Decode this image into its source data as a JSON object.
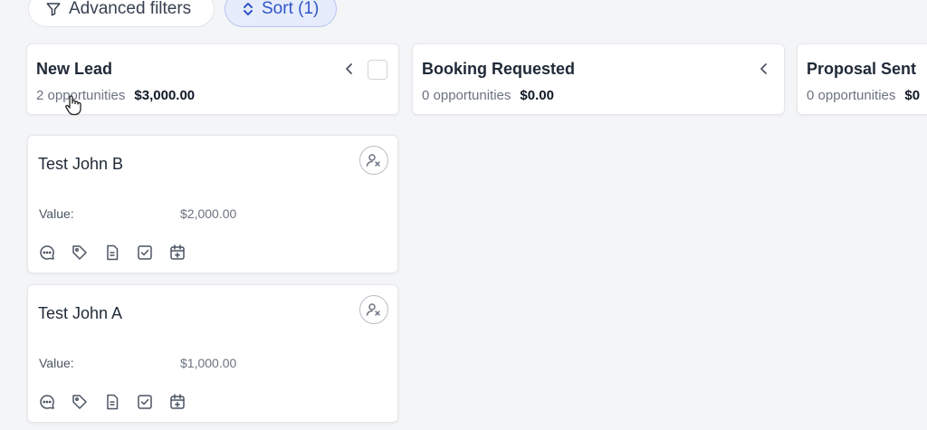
{
  "toolbar": {
    "filters_label": "Advanced filters",
    "sort_label": "Sort (1)"
  },
  "columns": [
    {
      "title": "New Lead",
      "count": "2 opportunities",
      "amount": "$3,000.00"
    },
    {
      "title": "Booking Requested",
      "count": "0 opportunities",
      "amount": "$0.00"
    },
    {
      "title": "Proposal Sent",
      "count": "0 opportunities",
      "amount": "$0"
    }
  ],
  "cards": [
    {
      "title": "Test John B",
      "value_label": "Value:",
      "value": "$2,000.00"
    },
    {
      "title": "Test John A",
      "value_label": "Value:",
      "value": "$1,000.00"
    }
  ],
  "card_actions": [
    "chat-icon",
    "tag-icon",
    "document-icon",
    "task-checkbox-icon",
    "calendar-add-icon"
  ],
  "colors": {
    "accent": "#2f56c8",
    "accent_bg": "#e6ecfb",
    "background": "#f4f5f6"
  }
}
